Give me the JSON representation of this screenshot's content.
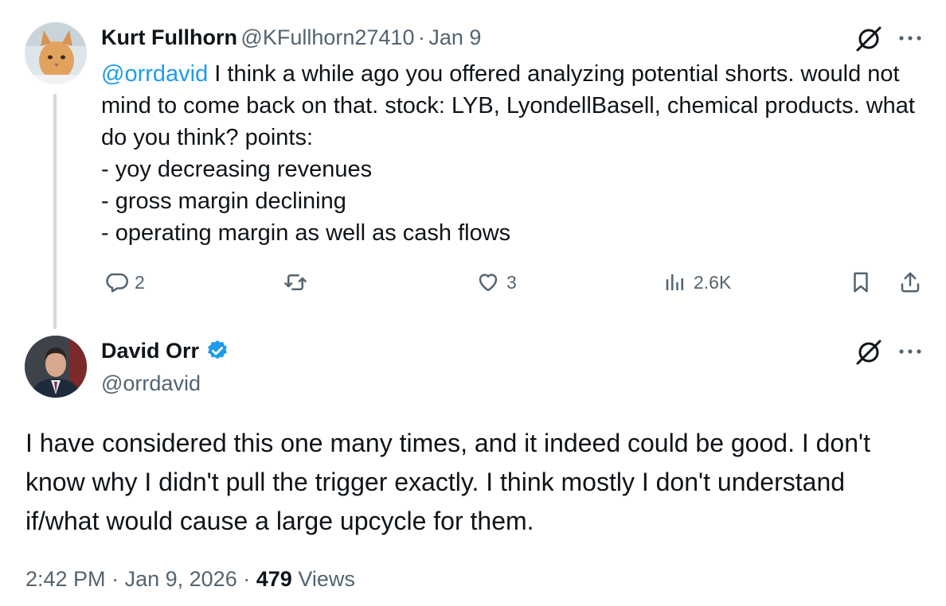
{
  "parent_tweet": {
    "author_name": "Kurt Fullhorn",
    "author_handle": "@KFullhorn27410",
    "separator": "·",
    "date": "Jan 9",
    "mention": "@orrdavid",
    "text_after_mention": " I think a while ago you offered analyzing potential shorts. would not mind to come back on that.  stock: LYB, LyondellBasell, chemical products. what do you think? points:\n- yoy decreasing revenues\n- gross margin declining\n- operating margin as well as cash flows",
    "actions": {
      "replies": "2",
      "likes": "3",
      "views": "2.6K"
    },
    "avatar_icon": "cat-avatar"
  },
  "main_tweet": {
    "author_name": "David Orr",
    "author_handle": "@orrdavid",
    "verified": true,
    "text": "I have considered this one many times, and it indeed could be good.  I don't know why I didn't pull the trigger exactly.  I think mostly I don't understand if/what would cause a large upcycle for them.",
    "time": "2:42 PM",
    "separator": "·",
    "date": "Jan 9, 2026",
    "separator2": "·",
    "views_count": "479",
    "views_label": "Views",
    "avatar_icon": "person-avatar"
  },
  "colors": {
    "accent": "#1d9bf0",
    "text": "#0f1419",
    "muted": "#536471",
    "thread_line": "#cfd9de"
  }
}
